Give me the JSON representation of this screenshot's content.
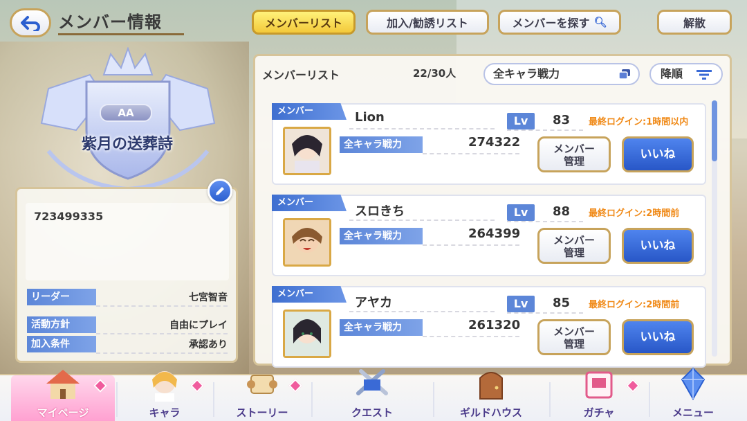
{
  "header": {
    "title": "メンバー情報",
    "tabs": [
      {
        "label": "メンバーリスト"
      },
      {
        "label": "加入/勧誘リスト"
      },
      {
        "label": "メンバーを探す"
      },
      {
        "label": "解散"
      }
    ]
  },
  "guild": {
    "rank": "AA",
    "name": "紫月の送葬詩",
    "id": "723499335",
    "leader_label": "リーダー",
    "leader": "七宮智音",
    "policy_label": "活動方針",
    "policy": "自由にプレイ",
    "join_label": "加入条件",
    "join": "承認あり"
  },
  "list": {
    "title": "メンバーリスト",
    "count": "22/30人",
    "sort": "全キャラ戦力",
    "order": "降順",
    "members": [
      {
        "role": "メンバー",
        "name": "Lion",
        "lv_label": "Lv",
        "lv": "83",
        "login": "最終ログイン:1時間以内",
        "power_label": "全キャラ戦力",
        "power": "274322",
        "manage": "メンバー\n管理",
        "like": "いいね"
      },
      {
        "role": "メンバー",
        "name": "スロきち",
        "lv_label": "Lv",
        "lv": "88",
        "login": "最終ログイン:2時間前",
        "power_label": "全キャラ戦力",
        "power": "264399",
        "manage": "メンバー\n管理",
        "like": "いいね"
      },
      {
        "role": "メンバー",
        "name": "アヤカ",
        "lv_label": "Lv",
        "lv": "85",
        "login": "最終ログイン:2時間前",
        "power_label": "全キャラ戦力",
        "power": "261320",
        "manage": "メンバー\n管理",
        "like": "いいね"
      }
    ]
  },
  "nav": {
    "items": [
      {
        "label": "マイページ",
        "icon": "home-icon"
      },
      {
        "label": "キャラ",
        "icon": "character-icon"
      },
      {
        "label": "ストーリー",
        "icon": "scroll-icon"
      },
      {
        "label": "クエスト",
        "icon": "sword-icon"
      },
      {
        "label": "ギルドハウス",
        "icon": "door-icon"
      },
      {
        "label": "ガチャ",
        "icon": "gacha-icon"
      },
      {
        "label": "メニュー",
        "icon": "crystal-icon"
      }
    ]
  },
  "colors": {
    "accent_blue": "#2857c7",
    "gold": "#c7a35b",
    "login_orange": "#f08a18",
    "active_pink": "#ff9fd0"
  }
}
